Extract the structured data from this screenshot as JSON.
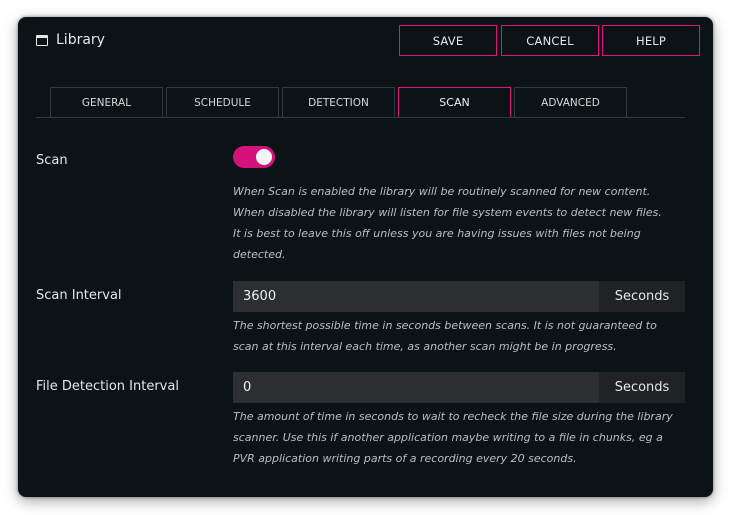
{
  "window": {
    "title": "Library"
  },
  "toolbar": {
    "save_label": "SAVE",
    "cancel_label": "CANCEL",
    "help_label": "HELP"
  },
  "tabs": [
    {
      "label": "GENERAL",
      "active": false
    },
    {
      "label": "SCHEDULE",
      "active": false
    },
    {
      "label": "DETECTION",
      "active": false
    },
    {
      "label": "SCAN",
      "active": true
    },
    {
      "label": "ADVANCED",
      "active": false
    }
  ],
  "scan": {
    "label": "Scan",
    "enabled": true,
    "description": [
      "When Scan is enabled the library will be routinely scanned for new content.",
      "When disabled the library will listen for file system events to detect new files.",
      "It is best to leave this off unless you are having issues with files not being",
      "detected."
    ]
  },
  "scan_interval": {
    "label": "Scan Interval",
    "value": "3600",
    "unit": "Seconds",
    "description": [
      "The shortest possible time in seconds between scans.  It is not guaranteed to",
      "scan at this interval each time, as another scan might be in progress."
    ]
  },
  "file_detection_interval": {
    "label": "File Detection Interval",
    "value": "0",
    "unit": "Seconds",
    "description": [
      "The amount of time in seconds to wait to recheck the file size during the library",
      "scanner.  Use this if another application maybe writing to a file in chunks, eg a",
      "PVR application writing parts of a recording every 20 seconds."
    ]
  },
  "colors": {
    "accent": "#e0137f",
    "background": "#0c1317",
    "input_bg": "#2b2f32"
  },
  "icons": {
    "title_icon": "window-icon"
  }
}
